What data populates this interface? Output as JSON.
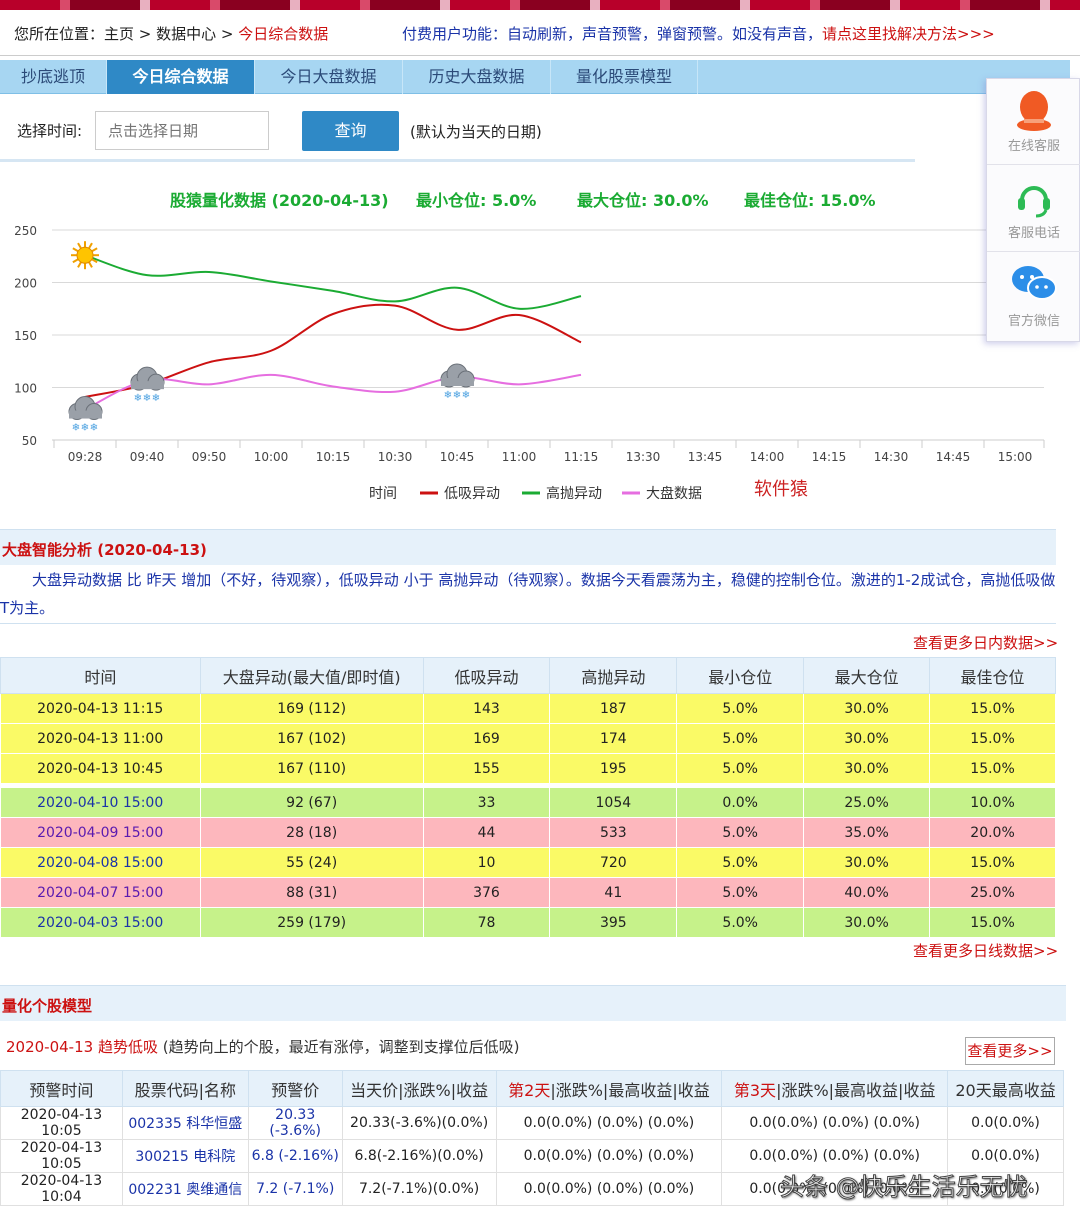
{
  "breadcrumb": {
    "prefix": "您所在位置：主页 > 数据中心 > ",
    "current": "今日综合数据"
  },
  "notice": {
    "text": "付费用户功能：自动刷新，声音预警，弹窗预警。如没有声音，",
    "fix_link": "请点这里找解决方法>>>"
  },
  "tabs": [
    {
      "label": "抄底逃顶",
      "active": false
    },
    {
      "label": "今日综合数据",
      "active": true
    },
    {
      "label": "今日大盘数据",
      "active": false
    },
    {
      "label": "历史大盘数据",
      "active": false
    },
    {
      "label": "量化股票模型",
      "active": false
    }
  ],
  "datebar": {
    "label": "选择时间:",
    "placeholder": "点击选择日期",
    "query": "查询",
    "hint": "(默认为当天的日期)"
  },
  "chart_header": {
    "title": "股猿量化数据 (2020-04-13)",
    "min_pos": "最小仓位:  5.0%",
    "max_pos": "最大仓位: 30.0%",
    "best_pos": "最佳仓位: 15.0%"
  },
  "chart_data": {
    "type": "line",
    "title": "股猿量化数据 (2020-04-13)",
    "x": [
      "09:28",
      "09:40",
      "09:50",
      "10:00",
      "10:15",
      "10:30",
      "10:45",
      "11:00",
      "11:15",
      "13:30",
      "13:45",
      "14:00",
      "14:15",
      "14:30",
      "14:45",
      "15:00"
    ],
    "yticks": [
      250,
      200,
      150,
      100,
      50
    ],
    "ylim": [
      50,
      250
    ],
    "legend_title": "时间",
    "series": [
      {
        "name": "低吸异动",
        "color": "#cc1111",
        "values": [
          91,
          103,
          124,
          135,
          170,
          178,
          155,
          169,
          143
        ]
      },
      {
        "name": "高抛异动",
        "color": "#1bab33",
        "values": [
          226,
          207,
          210,
          201,
          192,
          182,
          195,
          175,
          187
        ]
      },
      {
        "name": "大盘数据",
        "color": "#e66ee0",
        "values": [
          79,
          107,
          103,
          112,
          101,
          96,
          110,
          103,
          112
        ]
      }
    ],
    "icons": [
      {
        "type": "sun-icon",
        "x": "09:28",
        "y": 226
      },
      {
        "type": "snow-cloud-icon",
        "x": "09:28",
        "y": 79
      },
      {
        "type": "snow-cloud-icon",
        "x": "09:40",
        "y": 107
      },
      {
        "type": "snow-cloud-icon",
        "x": "10:45",
        "y": 110
      }
    ],
    "brand_label": "软件猿",
    "grid": true,
    "legend_position": "bottom"
  },
  "sidefloat": [
    {
      "icon": "qq-icon",
      "label": "在线客服"
    },
    {
      "icon": "headset-icon",
      "label": "客服电话"
    },
    {
      "icon": "wechat-icon",
      "label": "官方微信"
    }
  ],
  "analysis": {
    "title": "大盘智能分析 (2020-04-13)",
    "text": "大盘异动数据 比 昨天 增加（不好，待观察），低吸异动 小于 高抛异动（待观察）。数据今天看震荡为主，稳健的控制仓位。激进的1-2成试仓，高抛低吸做T为主。",
    "more_intraday": "查看更多日内数据>>",
    "more_daily": "查看更多日线数据>>"
  },
  "table1": {
    "headers": [
      "时间",
      "大盘异动(最大值/即时值)",
      "低吸异动",
      "高抛异动",
      "最小仓位",
      "最大仓位",
      "最佳仓位"
    ],
    "rows": [
      {
        "color": "yellow",
        "timecolor": "",
        "cells": [
          "2020-04-13 11:15",
          "169 (112)",
          "143",
          "187",
          "5.0%",
          "30.0%",
          "15.0%"
        ]
      },
      {
        "color": "yellow",
        "timecolor": "",
        "cells": [
          "2020-04-13 11:00",
          "167 (102)",
          "169",
          "174",
          "5.0%",
          "30.0%",
          "15.0%"
        ]
      },
      {
        "color": "yellow",
        "timecolor": "",
        "cells": [
          "2020-04-13 10:45",
          "167 (110)",
          "155",
          "195",
          "5.0%",
          "30.0%",
          "15.0%"
        ],
        "sep_after": true
      },
      {
        "color": "green",
        "timecolor": "blue",
        "cells": [
          "2020-04-10 15:00",
          "92 (67)",
          "33",
          "1054",
          "0.0%",
          "25.0%",
          "10.0%"
        ]
      },
      {
        "color": "pink",
        "timecolor": "purple",
        "cells": [
          "2020-04-09 15:00",
          "28 (18)",
          "44",
          "533",
          "5.0%",
          "35.0%",
          "20.0%"
        ]
      },
      {
        "color": "yellow",
        "timecolor": "blue",
        "cells": [
          "2020-04-08 15:00",
          "55 (24)",
          "10",
          "720",
          "5.0%",
          "30.0%",
          "15.0%"
        ]
      },
      {
        "color": "pink",
        "timecolor": "purple",
        "cells": [
          "2020-04-07 15:00",
          "88 (31)",
          "376",
          "41",
          "5.0%",
          "40.0%",
          "25.0%"
        ]
      },
      {
        "color": "green",
        "timecolor": "blue",
        "cells": [
          "2020-04-03 15:00",
          "259 (179)",
          "78",
          "395",
          "5.0%",
          "30.0%",
          "15.0%"
        ]
      }
    ]
  },
  "model": {
    "title": "量化个股模型",
    "line_red": "2020-04-13 趋势低吸",
    "line_desc": " (趋势向上的个股，最近有涨停，调整到支撑位后低吸)",
    "more": "查看更多>>",
    "headers": [
      {
        "red": "",
        "rest": "预警时间"
      },
      {
        "red": "",
        "rest": "股票代码|名称"
      },
      {
        "red": "",
        "rest": "预警价"
      },
      {
        "red": "",
        "rest": "当天价|涨跌%|收益"
      },
      {
        "red": "第2天",
        "rest": "|涨跌%|最高收益|收益"
      },
      {
        "red": "第3天",
        "rest": "|涨跌%|最高收益|收益"
      },
      {
        "red": "",
        "rest": "20天最高收益"
      }
    ],
    "rows": [
      [
        "2020-04-13 10:05",
        "002335 科华恒盛",
        "20.33 (-3.6%)",
        "20.33(-3.6%)(0.0%)",
        "0.0(0.0%) (0.0%) (0.0%)",
        "0.0(0.0%) (0.0%) (0.0%)",
        "0.0(0.0%)"
      ],
      [
        "2020-04-13 10:05",
        "300215 电科院",
        "6.8 (-2.16%)",
        "6.8(-2.16%)(0.0%)",
        "0.0(0.0%) (0.0%) (0.0%)",
        "0.0(0.0%) (0.0%) (0.0%)",
        "0.0(0.0%)"
      ],
      [
        "2020-04-13 10:04",
        "002231 奥维通信",
        "7.2 (-7.1%)",
        "7.2(-7.1%)(0.0%)",
        "0.0(0.0%) (0.0%) (0.0%)",
        "0.0(0.0%) (0.0%) (0.0%)",
        "0.0(0.0%)"
      ]
    ]
  },
  "watermark": "头条 @快乐生活乐无忧"
}
